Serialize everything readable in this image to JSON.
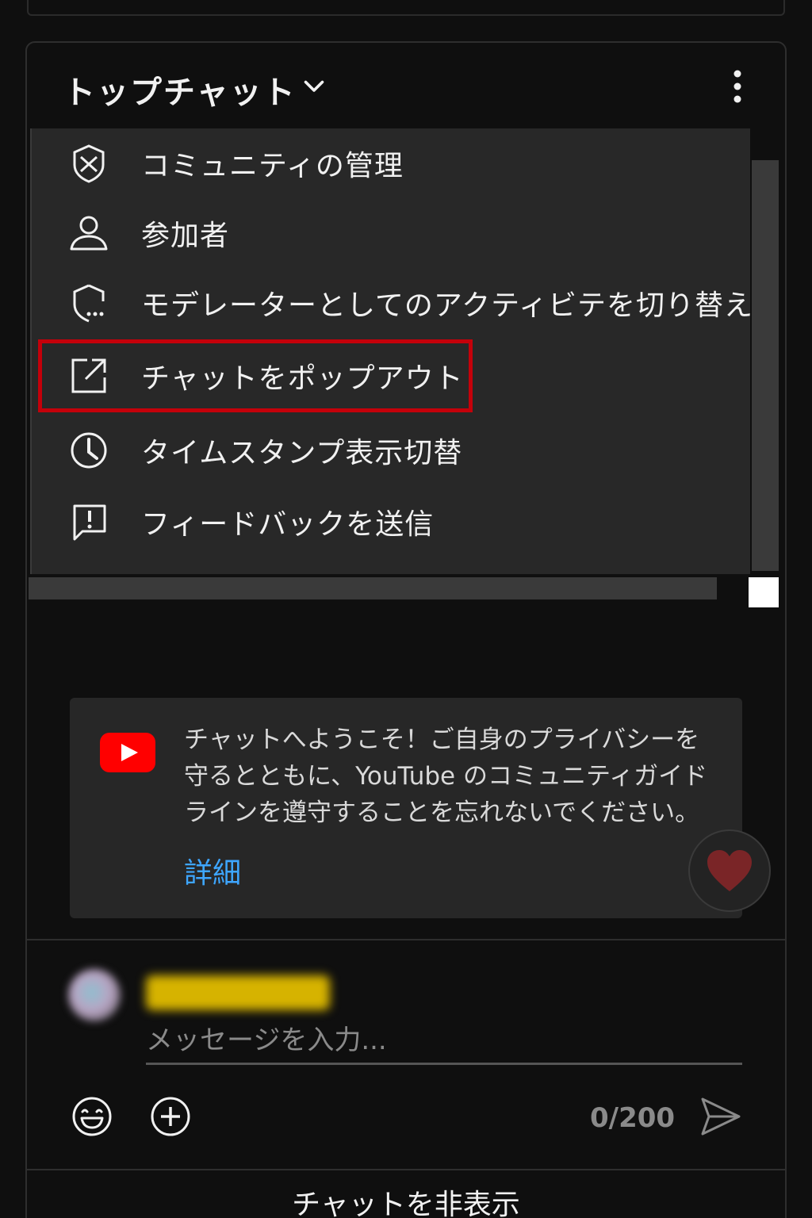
{
  "header": {
    "title": "トップチャット",
    "chevron_icon": "chevron-down-icon",
    "more_icon": "more-vert-icon"
  },
  "menu": {
    "items": [
      {
        "label": "コミュニティの管理",
        "icon": "shield-x-icon"
      },
      {
        "label": "参加者",
        "icon": "person-icon"
      },
      {
        "label": "モデレーターとしてのアクティビテを切り替え",
        "icon": "shield-chat-icon"
      },
      {
        "label": "チャットをポップアウト",
        "icon": "open-external-icon"
      },
      {
        "label": "タイムスタンプ表示切替",
        "icon": "clock-icon"
      },
      {
        "label": "フィードバックを送信",
        "icon": "feedback-icon"
      }
    ],
    "highlight_color": "#c4000a"
  },
  "welcome": {
    "text": "チャットへようこそ！ご自身のプライバシーを守るとともに、YouTube のコミュニティガイドラインを遵守することを忘れないでください。",
    "link": "詳細"
  },
  "input": {
    "placeholder": "メッセージを入力...",
    "char_count": "0/200"
  },
  "footer": {
    "hide_chat": "チャットを非表示"
  },
  "colors": {
    "background": "#0f0f0f",
    "menu_bg": "#282828",
    "link": "#3ea6ff",
    "youtube_red": "#ff0000"
  }
}
